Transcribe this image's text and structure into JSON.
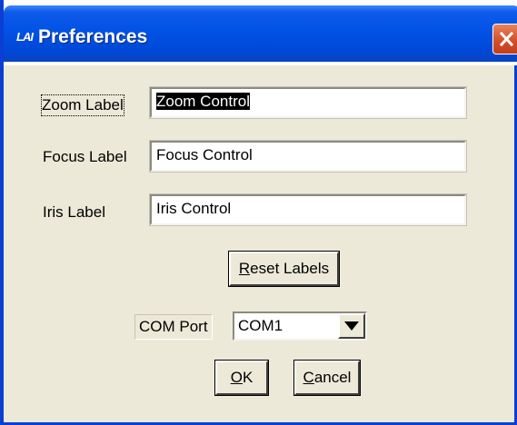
{
  "window": {
    "title": "Preferences",
    "app_icon_text": "LAI"
  },
  "form": {
    "zoom_label": "Zoom Label",
    "zoom_value": "Zoom Control",
    "focus_label": "Focus Label",
    "focus_value": "Focus Control",
    "iris_label": "Iris Label",
    "iris_value": "Iris Control",
    "com_port_label": "COM Port",
    "com_port_value": "COM1"
  },
  "buttons": {
    "reset_first": "R",
    "reset_rest": "eset Labels",
    "ok_first": "O",
    "ok_rest": "K",
    "cancel_first": "C",
    "cancel_rest": "ancel"
  },
  "colors": {
    "title_bar": "#0152e5",
    "dialog_bg": "#ece9d8",
    "close_button": "#d4502b"
  }
}
